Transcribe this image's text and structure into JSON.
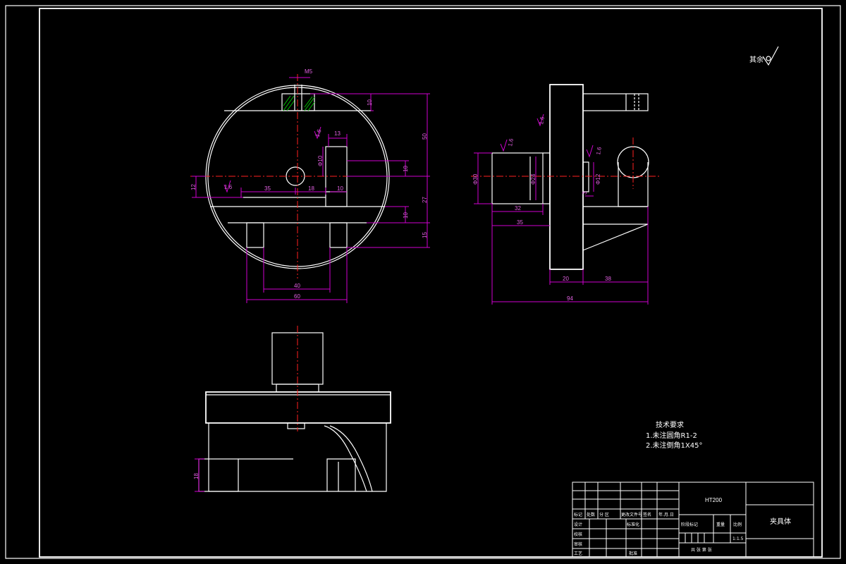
{
  "surface_symbol": "其余",
  "notes": {
    "heading": "技术要求",
    "line1": "1.未注圆角R1-2",
    "line2": "2.未注倒角1X45°"
  },
  "dimensions": {
    "front": {
      "d_top": "M5",
      "d10a": "10",
      "d50": "50",
      "d13": "13",
      "phi10": "Φ10",
      "d10b": "10",
      "d12": "12",
      "d35": "35",
      "d18": "18",
      "d10c": "10",
      "d27": "27",
      "d10d": "10",
      "d15": "15",
      "d40": "40",
      "d60": "60",
      "rough1": "1.6",
      "rough2": "1.6"
    },
    "side": {
      "phi30": "Φ30",
      "phi24": "Φ24",
      "phi12": "Φ12",
      "d32": "32",
      "d35": "35",
      "d20": "20",
      "d38": "38",
      "d94": "94",
      "d3": "3",
      "rough1": "1.6",
      "rough2": "1.6",
      "rough3": "1.6"
    },
    "plan": {
      "d18": "18"
    }
  },
  "title_block": {
    "material": "HT200",
    "part_name": "夹具体",
    "row_labels": [
      "标记",
      "设计",
      "校核",
      "审核",
      "工艺"
    ],
    "header_cells": [
      "处数",
      "分 区",
      "更改文件号",
      "签名",
      "年.月.日"
    ],
    "std_label": "标准化",
    "approve_label": "批准",
    "stage_label": "阶段标记",
    "weight_label": "重量",
    "scale_label": "比例",
    "scale_value": "1:1.5",
    "sheet_info": "共 张 第 张"
  }
}
